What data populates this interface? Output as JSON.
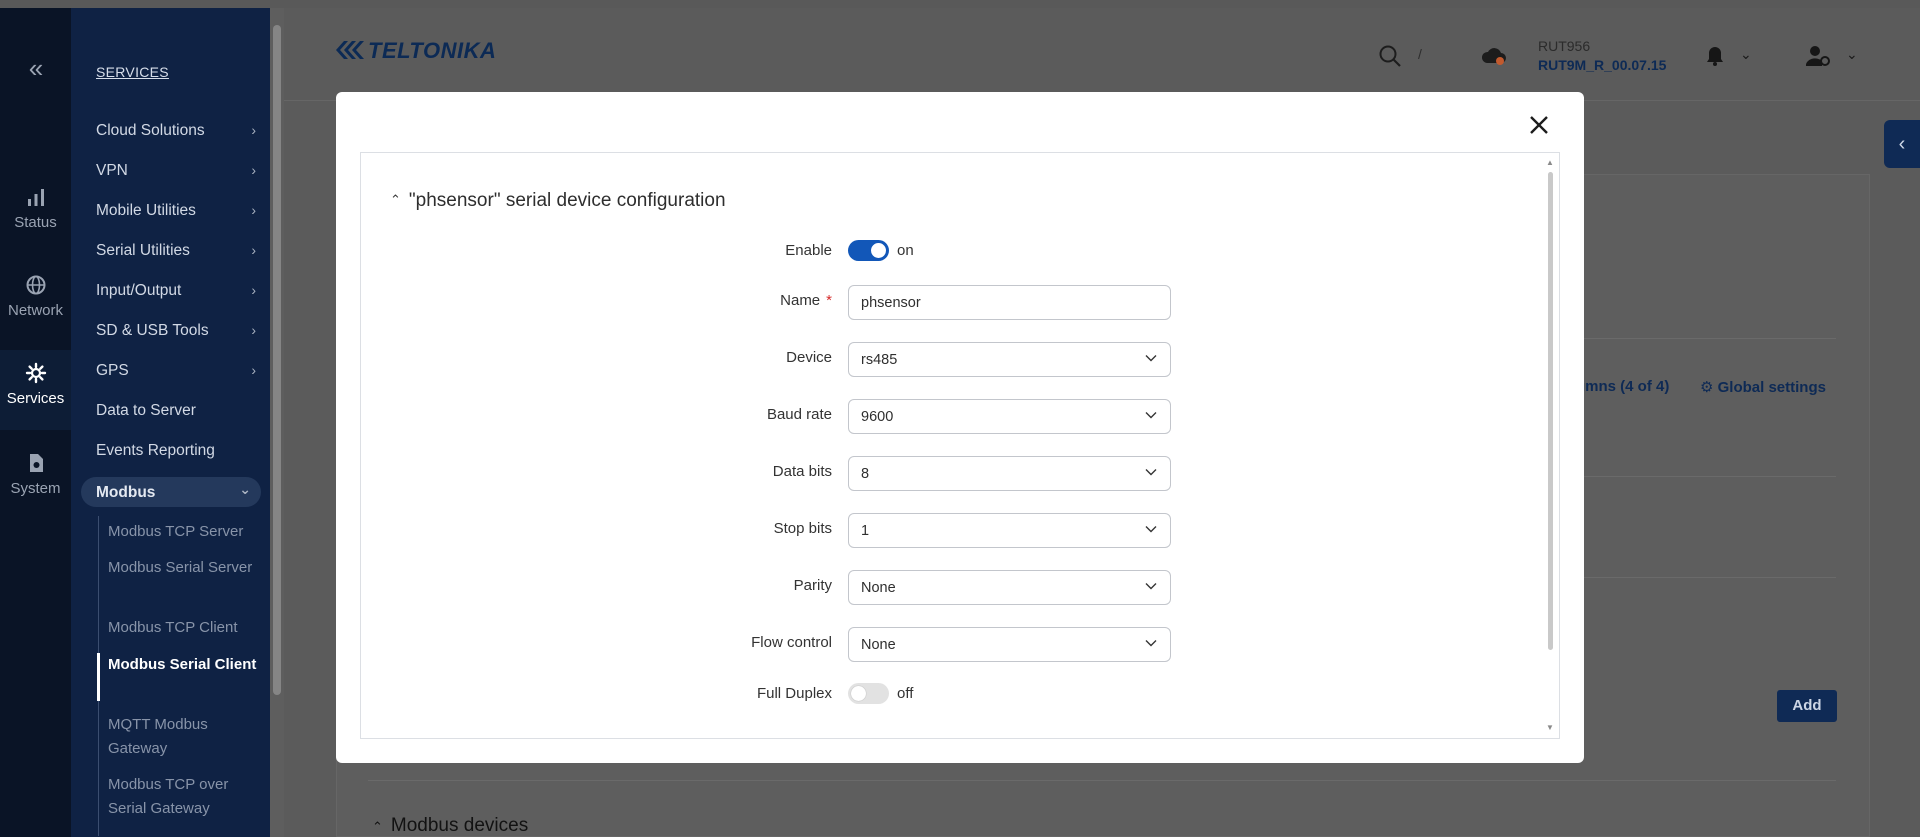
{
  "rail": {
    "items": [
      {
        "label": "Status",
        "icon": "bar-chart-icon"
      },
      {
        "label": "Network",
        "icon": "globe-icon"
      },
      {
        "label": "Services",
        "icon": "gear-icon",
        "active": true
      },
      {
        "label": "System",
        "icon": "system-file-icon"
      }
    ]
  },
  "sidebar": {
    "title": "SERVICES",
    "items": [
      {
        "label": "Cloud Solutions",
        "chevron": "›"
      },
      {
        "label": "VPN",
        "chevron": "›"
      },
      {
        "label": "Mobile Utilities",
        "chevron": "›"
      },
      {
        "label": "Serial Utilities",
        "chevron": "›"
      },
      {
        "label": "Input/Output",
        "chevron": "›"
      },
      {
        "label": "SD & USB Tools",
        "chevron": "›"
      },
      {
        "label": "GPS",
        "chevron": "›"
      },
      {
        "label": "Data to Server"
      },
      {
        "label": "Events Reporting"
      },
      {
        "label": "Modbus",
        "chevron": "⌄"
      }
    ],
    "sub_items": [
      {
        "label": "Modbus TCP Server"
      },
      {
        "label": "Modbus Serial Server"
      },
      {
        "label": "Modbus TCP Client"
      },
      {
        "label": "Modbus Serial Client",
        "active": true
      },
      {
        "label": "MQTT Modbus Gateway"
      },
      {
        "label": "Modbus TCP over Serial Gateway"
      }
    ]
  },
  "header": {
    "logo": "TELTONIKA",
    "search_shortcut": "/",
    "device_name": "RUT956",
    "firmware": "RUT9M_R_00.07.15"
  },
  "background": {
    "columns_label": "umns (4 of 4)",
    "global_settings_label": "Global settings",
    "add_label": "Add",
    "devices_section": "Modbus devices"
  },
  "modal": {
    "title": "\"phsensor\" serial device configuration",
    "fields": {
      "enable": {
        "label": "Enable",
        "state": "on"
      },
      "name": {
        "label": "Name",
        "value": "phsensor",
        "required_mark": "*"
      },
      "device": {
        "label": "Device",
        "value": "rs485"
      },
      "baud_rate": {
        "label": "Baud rate",
        "value": "9600"
      },
      "data_bits": {
        "label": "Data bits",
        "value": "8"
      },
      "stop_bits": {
        "label": "Stop bits",
        "value": "1"
      },
      "parity": {
        "label": "Parity",
        "value": "None"
      },
      "flow_control": {
        "label": "Flow control",
        "value": "None"
      },
      "full_duplex": {
        "label": "Full Duplex",
        "state": "off"
      }
    }
  },
  "colors": {
    "sidebar_bg": "#0f2244",
    "rail_bg": "#0a1426",
    "accent": "#1257b8",
    "brand_navy": "#0f2a55"
  }
}
